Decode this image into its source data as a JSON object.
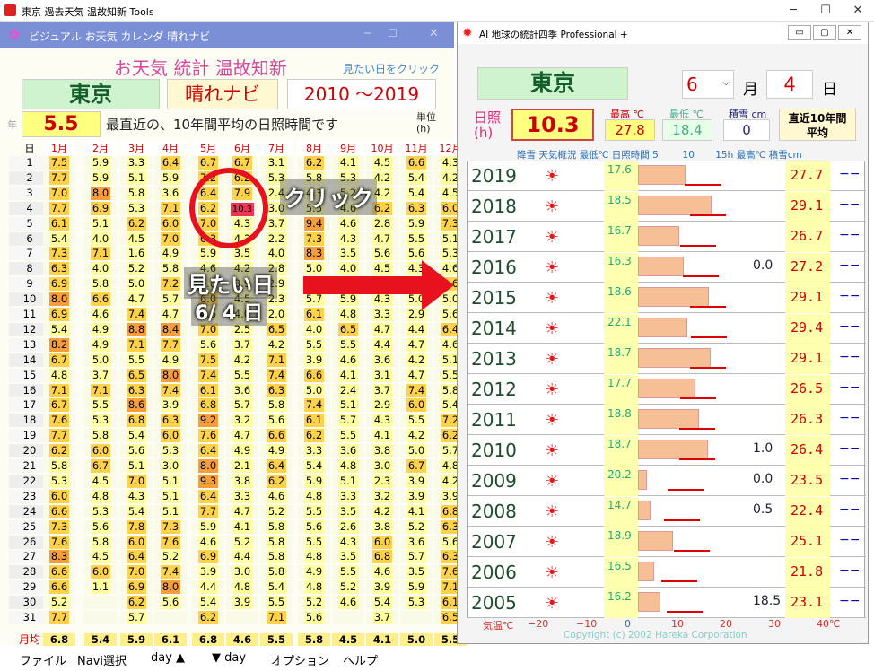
{
  "app": {
    "title": "東京 過去天気 温故知新 Tools",
    "sub_title": "ビジュアル お天気 カレンダ 晴れナビ"
  },
  "left": {
    "header_title": "お天気 統計 温故知新",
    "hint": "見たい日をクリック",
    "city": "東京",
    "navi": "晴れナビ",
    "period": "2010 ～2019",
    "year_label": "年",
    "value": "5.5",
    "desc": "最直近の、10年間平均の日照時間です",
    "unit": "単位\n(h)",
    "day_header": "日",
    "months": [
      "1月",
      "2月",
      "3月",
      "4月",
      "5月",
      "6月",
      "7月",
      "8月",
      "9月",
      "10月",
      "11月",
      "12月"
    ],
    "rows": [
      [
        "7.5",
        "5.9",
        "3.3",
        "6.4",
        "6.7",
        "6.7",
        "3.1",
        "6.2",
        "4.1",
        "4.5",
        "6.6",
        "4.3"
      ],
      [
        "7.7",
        "5.9",
        "5.1",
        "5.9",
        "7.2",
        "6.2",
        "5.3",
        "5.8",
        "5.3",
        "4.2",
        "5.4",
        "4.2"
      ],
      [
        "7.0",
        "8.0",
        "5.8",
        "3.6",
        "6.4",
        "7.9",
        "2.4",
        "4.3",
        "5.2",
        "4.2",
        "5.4",
        "4.5"
      ],
      [
        "7.7",
        "6.9",
        "5.3",
        "7.1",
        "6.2",
        "10.3",
        "3.0",
        "5.5",
        "4.6",
        "6.2",
        "6.3",
        "6.0"
      ],
      [
        "6.1",
        "5.1",
        "6.2",
        "6.0",
        "7.0",
        "4.3",
        "3.7",
        "9.4",
        "4.6",
        "2.8",
        "5.9",
        "7.3"
      ],
      [
        "5.4",
        "4.0",
        "4.5",
        "7.0",
        "6.3",
        "4.3",
        "2.2",
        "7.3",
        "4.3",
        "4.7",
        "5.5",
        "5.1"
      ],
      [
        "7.3",
        "7.1",
        "1.6",
        "4.9",
        "5.9",
        "3.5",
        "4.0",
        "8.3",
        "3.5",
        "5.6",
        "5.6",
        "5.3"
      ],
      [
        "6.3",
        "4.0",
        "5.2",
        "5.8",
        "4.6",
        "4.2",
        "2.8",
        "5.0",
        "4.0",
        "4.5",
        "4.3",
        "4.6"
      ],
      [
        "6.9",
        "5.8",
        "5.0",
        "7.2",
        "5.8",
        "3.9",
        "2.9",
        "6.0",
        "6.1",
        "4.3",
        "5.6",
        "6.6"
      ],
      [
        "8.0",
        "6.6",
        "4.7",
        "5.7",
        "6.0",
        "4.5",
        "2.3",
        "5.7",
        "5.9",
        "4.3",
        "5.0",
        "5.0"
      ],
      [
        "6.9",
        "4.6",
        "7.4",
        "4.7",
        "4.6",
        "4.0",
        "2.0",
        "6.1",
        "4.8",
        "3.3",
        "2.9",
        "5.6"
      ],
      [
        "5.4",
        "4.9",
        "8.8",
        "8.4",
        "7.0",
        "2.5",
        "6.5",
        "4.0",
        "6.5",
        "4.7",
        "4.4",
        "6.4"
      ],
      [
        "8.2",
        "4.9",
        "7.1",
        "7.7",
        "5.6",
        "3.7",
        "4.2",
        "5.5",
        "5.5",
        "4.4",
        "4.7",
        "4.6"
      ],
      [
        "6.7",
        "5.0",
        "5.5",
        "4.9",
        "7.5",
        "4.2",
        "7.1",
        "3.9",
        "4.6",
        "3.6",
        "4.2",
        "5.1"
      ],
      [
        "4.8",
        "3.7",
        "6.5",
        "8.0",
        "7.4",
        "5.5",
        "7.4",
        "6.6",
        "4.1",
        "3.1",
        "4.7",
        "5.5"
      ],
      [
        "7.1",
        "7.1",
        "6.3",
        "7.4",
        "6.1",
        "3.6",
        "6.3",
        "5.0",
        "2.4",
        "3.7",
        "7.4",
        "5.8"
      ],
      [
        "6.7",
        "5.5",
        "8.6",
        "3.9",
        "6.8",
        "5.7",
        "5.8",
        "7.4",
        "5.1",
        "2.9",
        "6.0",
        "5.4"
      ],
      [
        "7.6",
        "5.3",
        "6.8",
        "6.3",
        "9.2",
        "3.2",
        "5.6",
        "6.1",
        "5.7",
        "4.3",
        "5.5",
        "7.2"
      ],
      [
        "7.7",
        "5.8",
        "5.4",
        "6.0",
        "7.6",
        "4.7",
        "6.6",
        "6.2",
        "5.5",
        "4.1",
        "4.2",
        "6.2"
      ],
      [
        "6.2",
        "6.0",
        "5.6",
        "5.3",
        "6.4",
        "4.9",
        "4.9",
        "3.3",
        "3.6",
        "3.8",
        "5.0",
        "5.7"
      ],
      [
        "5.8",
        "6.7",
        "5.1",
        "3.0",
        "8.0",
        "2.1",
        "6.4",
        "5.4",
        "4.8",
        "3.0",
        "6.7",
        "4.8"
      ],
      [
        "5.3",
        "4.5",
        "7.0",
        "5.1",
        "9.3",
        "3.8",
        "6.2",
        "5.9",
        "5.1",
        "2.3",
        "3.9",
        "4.2"
      ],
      [
        "6.0",
        "4.8",
        "4.3",
        "5.1",
        "6.4",
        "3.3",
        "4.6",
        "4.8",
        "3.3",
        "3.2",
        "3.9",
        "3.9"
      ],
      [
        "6.6",
        "5.3",
        "5.4",
        "5.1",
        "7.7",
        "4.7",
        "5.2",
        "5.5",
        "3.5",
        "4.2",
        "4.1",
        "6.8"
      ],
      [
        "7.3",
        "5.6",
        "7.8",
        "7.3",
        "5.9",
        "4.1",
        "5.8",
        "5.6",
        "2.6",
        "3.8",
        "5.2",
        "6.3"
      ],
      [
        "7.6",
        "5.8",
        "6.0",
        "7.6",
        "4.6",
        "5.2",
        "5.8",
        "5.5",
        "4.3",
        "6.0",
        "3.6",
        "5.6"
      ],
      [
        "8.3",
        "4.5",
        "6.4",
        "5.2",
        "6.9",
        "4.4",
        "5.8",
        "4.8",
        "3.5",
        "6.8",
        "5.7",
        "6.3"
      ],
      [
        "6.6",
        "6.0",
        "7.0",
        "7.4",
        "3.9",
        "3.0",
        "5.8",
        "4.9",
        "5.5",
        "4.6",
        "3.5",
        "7.6"
      ],
      [
        "6.6",
        "1.1",
        "6.9",
        "8.0",
        "4.4",
        "4.8",
        "5.4",
        "4.8",
        "5.2",
        "3.9",
        "5.9",
        "7.1"
      ],
      [
        "5.2",
        "",
        "6.2",
        "5.6",
        "5.4",
        "3.9",
        "5.5",
        "5.2",
        "4.6",
        "5.4",
        "5.3",
        "6.1"
      ],
      [
        "7.7",
        "",
        "5.7",
        "",
        "6.2",
        "",
        "7.1",
        "5.6",
        "",
        "3.7",
        "",
        "6.5"
      ]
    ],
    "avg_label": "月均",
    "avg": [
      "6.8",
      "5.4",
      "5.9",
      "6.1",
      "6.8",
      "4.6",
      "5.5",
      "5.8",
      "4.5",
      "4.1",
      "5.0",
      "5.5"
    ],
    "annot_click": "クリック",
    "annot_day": "見たい日",
    "annot_date": "6/ 4 日"
  },
  "right": {
    "title": "AI 地球の統計四季 Professional +",
    "city": "東京",
    "month": "6",
    "month_unit": "月",
    "day": "4",
    "day_unit": "日",
    "sun_label": "日照\n(h)",
    "sun_value": "10.3",
    "max_label": "最高 ℃",
    "max_value": "27.8",
    "min_label": "最低 ℃",
    "min_value": "18.4",
    "snow_label": "積雪 cm",
    "snow_value": "0",
    "recent_label": "直近10年間\n平均",
    "col_header": "降雪 天気概況 最低℃ 日照時間 5        10       15h 最高℃ 積雪cm",
    "years": [
      {
        "year": "2019",
        "low": "17.6",
        "sun": 5.5,
        "rain": "",
        "high": "27.7",
        "snow": "−−"
      },
      {
        "year": "2018",
        "low": "18.5",
        "sun": 8.5,
        "rain": "",
        "high": "29.1",
        "snow": "−−"
      },
      {
        "year": "2017",
        "low": "16.7",
        "sun": 4.8,
        "rain": "",
        "high": "26.7",
        "snow": "−−"
      },
      {
        "year": "2016",
        "low": "16.3",
        "sun": 5.3,
        "rain": "0.0",
        "high": "27.2",
        "snow": "−−"
      },
      {
        "year": "2015",
        "low": "18.6",
        "sun": 8.2,
        "rain": "",
        "high": "29.1",
        "snow": "−−"
      },
      {
        "year": "2014",
        "low": "22.1",
        "sun": 5.7,
        "rain": "",
        "high": "29.4",
        "snow": "−−"
      },
      {
        "year": "2013",
        "low": "18.7",
        "sun": 8.4,
        "rain": "",
        "high": "29.1",
        "snow": "−−"
      },
      {
        "year": "2012",
        "low": "17.7",
        "sun": 6.7,
        "rain": "",
        "high": "26.5",
        "snow": "−−"
      },
      {
        "year": "2011",
        "low": "18.8",
        "sun": 7.1,
        "rain": "",
        "high": "26.3",
        "snow": "−−"
      },
      {
        "year": "2010",
        "low": "18.7",
        "sun": 8.1,
        "rain": "1.0",
        "high": "26.4",
        "snow": "−−"
      },
      {
        "year": "2009",
        "low": "20.2",
        "sun": 1.0,
        "rain": "0.0",
        "high": "23.5",
        "snow": "−−"
      },
      {
        "year": "2008",
        "low": "14.7",
        "sun": 1.5,
        "rain": "0.5",
        "high": "22.4",
        "snow": "−−"
      },
      {
        "year": "2007",
        "low": "18.9",
        "sun": 4.1,
        "rain": "",
        "high": "25.1",
        "snow": "−−"
      },
      {
        "year": "2006",
        "low": "16.5",
        "sun": 1.9,
        "rain": "",
        "high": "21.8",
        "snow": "−−"
      },
      {
        "year": "2005",
        "low": "16.2",
        "sun": 2.6,
        "rain": "18.5",
        "high": "23.1",
        "snow": "−−"
      }
    ],
    "axis_label": "気温℃",
    "axis_ticks": [
      "−20",
      "−10",
      "0",
      "10",
      "20",
      "30",
      "40℃"
    ],
    "copyright": "Copyright (c) 2002 Hareka Corporation"
  },
  "menubar": [
    "ファイル",
    "Navi選択",
    "day ▲",
    "▼ day",
    "オプション",
    "ヘルプ"
  ]
}
